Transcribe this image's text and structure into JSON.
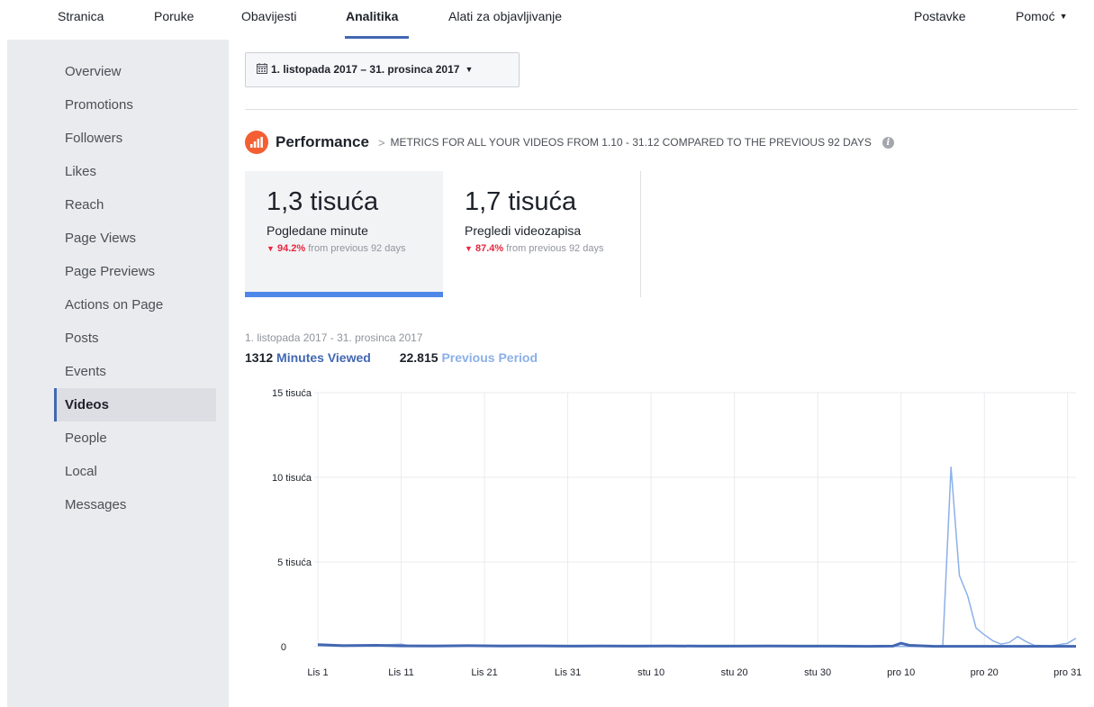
{
  "topnav": {
    "items": [
      "Stranica",
      "Poruke",
      "Obavijesti",
      "Analitika",
      "Alati za objavljivanje"
    ],
    "right": [
      "Postavke",
      "Pomoć"
    ]
  },
  "sidebar": {
    "items": [
      "Overview",
      "Promotions",
      "Followers",
      "Likes",
      "Reach",
      "Page Views",
      "Page Previews",
      "Actions on Page",
      "Posts",
      "Events",
      "Videos",
      "People",
      "Local",
      "Messages"
    ],
    "active": "Videos"
  },
  "main": {
    "date_range": "1. listopada 2017 – 31. prosinca 2017",
    "performance_title": "Performance",
    "performance_desc": "METRICS FOR ALL YOUR VIDEOS FROM 1.10 - 31.12 COMPARED TO THE PREVIOUS 92 DAYS",
    "metrics": [
      {
        "value": "1,3 tisuća",
        "label": "Pogledane minute",
        "change": "94.2%",
        "change_text": "from previous 92 days"
      },
      {
        "value": "1,7 tisuća",
        "label": "Pregledi videozapisa",
        "change": "87.4%",
        "change_text": "from previous 92 days"
      }
    ],
    "chart_date": "1. listopada 2017 - 31. prosinca 2017",
    "legend": [
      {
        "num": "1312",
        "label": "Minutes Viewed",
        "color": "#4267b2"
      },
      {
        "num": "22.815",
        "label": "Previous Period",
        "color": "#8bb0e8"
      }
    ]
  },
  "chart_data": {
    "type": "line",
    "x_ticks": [
      "Lis 1",
      "Lis 11",
      "Lis 21",
      "Lis 31",
      "stu 10",
      "stu 20",
      "stu 30",
      "pro 10",
      "pro 20",
      "pro 31"
    ],
    "y_ticks": [
      "0",
      "5 tisuća",
      "10 tisuća",
      "15 tisuća"
    ],
    "ylim": [
      0,
      15000
    ],
    "x_days": 92,
    "series": [
      {
        "name": "Minutes Viewed",
        "color": "#4267b2",
        "points": [
          [
            0,
            120
          ],
          [
            3,
            60
          ],
          [
            7,
            80
          ],
          [
            10,
            50
          ],
          [
            14,
            40
          ],
          [
            18,
            60
          ],
          [
            22,
            40
          ],
          [
            26,
            50
          ],
          [
            30,
            30
          ],
          [
            34,
            40
          ],
          [
            38,
            30
          ],
          [
            42,
            40
          ],
          [
            46,
            30
          ],
          [
            50,
            30
          ],
          [
            54,
            40
          ],
          [
            58,
            30
          ],
          [
            62,
            30
          ],
          [
            66,
            20
          ],
          [
            69,
            30
          ],
          [
            70,
            200
          ],
          [
            71,
            80
          ],
          [
            74,
            20
          ],
          [
            80,
            20
          ],
          [
            86,
            20
          ],
          [
            90,
            20
          ],
          [
            91,
            20
          ]
        ]
      },
      {
        "name": "Previous Period",
        "color": "#8bb0e8",
        "points": [
          [
            0,
            60
          ],
          [
            5,
            40
          ],
          [
            10,
            150
          ],
          [
            11,
            60
          ],
          [
            20,
            30
          ],
          [
            30,
            20
          ],
          [
            40,
            10
          ],
          [
            50,
            10
          ],
          [
            60,
            10
          ],
          [
            70,
            10
          ],
          [
            75,
            0
          ],
          [
            76,
            10600
          ],
          [
            77,
            4200
          ],
          [
            78,
            3000
          ],
          [
            79,
            1100
          ],
          [
            80,
            700
          ],
          [
            81,
            350
          ],
          [
            82,
            150
          ],
          [
            83,
            250
          ],
          [
            84,
            600
          ],
          [
            85,
            300
          ],
          [
            86,
            80
          ],
          [
            88,
            50
          ],
          [
            90,
            200
          ],
          [
            91,
            500
          ]
        ]
      }
    ]
  }
}
